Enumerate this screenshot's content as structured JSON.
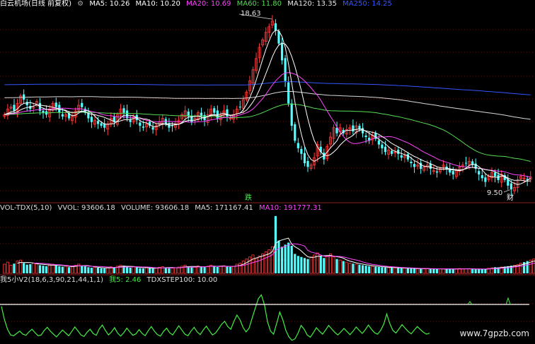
{
  "price_header": {
    "name": "白云机场(日线 前复权)",
    "items": [
      {
        "text": "MA5: 10.26",
        "color": "#ffffff"
      },
      {
        "text": "MA10: 10.20",
        "color": "#ffffff"
      },
      {
        "text": "MA20: 10.69",
        "color": "#ff44ff"
      },
      {
        "text": "MA60: 11.80",
        "color": "#55dd55"
      },
      {
        "text": "MA120: 13.35",
        "color": "#e8e8e8"
      },
      {
        "text": "MA250: 14.25",
        "color": "#3355ff"
      }
    ]
  },
  "vol_header": {
    "name": "VOL-TDX(5,10)",
    "items": [
      {
        "text": "VVOL: 93606.18",
        "color": "#dddddd"
      },
      {
        "text": "VOLUME: 93606.18",
        "color": "#dddddd"
      },
      {
        "text": "MA5: 171167.41",
        "color": "#dddddd"
      },
      {
        "text": "MA10: 191777.31",
        "color": "#ff44ff"
      }
    ]
  },
  "ind_header": {
    "name": "我5小V2(18,6,3,90,21,44,1,1)",
    "items": [
      {
        "text": "我5: 2.46",
        "color": "#44ee44"
      },
      {
        "text": "TDXSTEP100: 10.00",
        "color": "#dddddd"
      }
    ]
  },
  "annotations": {
    "high_label": "18.63",
    "low_label": "9.50",
    "event_1": "跌",
    "event_2": "财"
  },
  "watermark": "www.7gpzb.com",
  "chart_data": [
    {
      "type": "candlestick",
      "title": "白云机场(日线 前复权)",
      "ylim": [
        9.0,
        19.2
      ],
      "grid": true,
      "legend": "top-left",
      "close": [
        13.6,
        13.9,
        14.0,
        13.8,
        14.2,
        14.6,
        14.4,
        14.1,
        13.9,
        14.0,
        14.3,
        13.8,
        13.7,
        13.6,
        13.9,
        14.2,
        14.0,
        13.7,
        13.5,
        13.6,
        13.4,
        13.5,
        13.8,
        14.1,
        14.0,
        13.7,
        13.4,
        13.2,
        13.3,
        13.1,
        13.0,
        12.9,
        13.1,
        13.4,
        13.2,
        13.6,
        13.9,
        13.7,
        13.4,
        13.2,
        13.5,
        13.3,
        13.0,
        12.9,
        13.1,
        13.0,
        12.8,
        13.0,
        13.2,
        13.4,
        13.1,
        12.9,
        13.0,
        13.1,
        13.3,
        13.6,
        13.8,
        13.5,
        13.2,
        13.4,
        13.7,
        13.5,
        13.3,
        13.6,
        13.9,
        13.7,
        13.4,
        13.6,
        13.8,
        13.5,
        13.4,
        13.6,
        13.9,
        14.0,
        14.4,
        14.8,
        15.4,
        16.0,
        16.6,
        17.2,
        17.6,
        18.0,
        18.3,
        18.6,
        18.1,
        17.4,
        16.5,
        15.4,
        14.2,
        13.0,
        12.2,
        11.8,
        11.5,
        11.0,
        10.8,
        10.9,
        11.3,
        12.0,
        11.6,
        11.2,
        11.9,
        12.4,
        12.9,
        12.6,
        12.9,
        12.6,
        12.8,
        12.9,
        12.7,
        13.0,
        12.8,
        12.6,
        12.4,
        12.2,
        12.5,
        12.3,
        12.0,
        11.8,
        11.6,
        11.7,
        11.5,
        11.6,
        11.5,
        11.3,
        11.4,
        11.2,
        11.0,
        10.8,
        10.9,
        10.7,
        10.8,
        10.9,
        10.7,
        10.6,
        10.5,
        10.7,
        10.9,
        10.7,
        10.5,
        10.4,
        10.6,
        10.8,
        10.9,
        11.0,
        11.1,
        10.9,
        10.7,
        10.4,
        10.2,
        10.0,
        10.3,
        10.5,
        10.3,
        10.1,
        10.4,
        10.1,
        9.8,
        9.6,
        9.7,
        10.1,
        10.3,
        10.2,
        10.1,
        10.26
      ],
      "markers": {
        "high": 18.63,
        "low": 9.5
      }
    },
    {
      "type": "bar",
      "title": "VOL-TDX(5,10)",
      "ylim": [
        0,
        600000
      ],
      "legend": "top-left",
      "values": [
        90000,
        110000,
        80000,
        95000,
        120000,
        130000,
        100000,
        85000,
        90000,
        100000,
        95000,
        80000,
        75000,
        70000,
        85000,
        90000,
        80000,
        70000,
        65000,
        70000,
        60000,
        65000,
        80000,
        90000,
        75000,
        70000,
        60000,
        55000,
        60000,
        55000,
        50000,
        48000,
        55000,
        65000,
        60000,
        70000,
        80000,
        75000,
        60000,
        55000,
        65000,
        60000,
        50000,
        48000,
        55000,
        52000,
        48000,
        52000,
        60000,
        65000,
        55000,
        50000,
        52000,
        55000,
        62000,
        70000,
        80000,
        65000,
        58000,
        62000,
        72000,
        66000,
        60000,
        70000,
        80000,
        74000,
        62000,
        68000,
        75000,
        66000,
        62000,
        70000,
        90000,
        100000,
        120000,
        140000,
        160000,
        180000,
        150000,
        170000,
        190000,
        210000,
        230000,
        260000,
        560000,
        320000,
        260000,
        280000,
        300000,
        270000,
        190000,
        170000,
        160000,
        150000,
        140000,
        160000,
        180000,
        200000,
        170000,
        150000,
        170000,
        190000,
        160000,
        140000,
        130000,
        120000,
        110000,
        100000,
        95000,
        90000,
        85000,
        80000,
        75000,
        70000,
        68000,
        65000,
        62000,
        60000,
        58000,
        56000,
        55000,
        54000,
        52000,
        50000,
        50000,
        48000,
        47000,
        46000,
        45000,
        44000,
        45000,
        46000,
        44000,
        43000,
        42000,
        44000,
        45000,
        43000,
        42000,
        41000,
        45000,
        48000,
        46000,
        44000,
        43000,
        42000,
        40000,
        40000,
        42000,
        45000,
        50000,
        55000,
        60000,
        58000,
        62000,
        66000,
        70000,
        75000,
        80000,
        85000,
        100000,
        110000,
        120000,
        130000,
        140000,
        93606.18
      ]
    },
    {
      "type": "line",
      "title": "我5小V2(18,6,3,90,21,44,1,1)",
      "ylim": [
        0,
        15
      ],
      "legend": "top-left",
      "series": [
        {
          "name": "我5",
          "values": [
            9.5,
            6.0,
            3.5,
            2.0,
            1.8,
            2.4,
            3.0,
            2.2,
            1.9,
            2.8,
            3.5,
            2.6,
            1.8,
            2.0,
            3.2,
            4.0,
            3.0,
            2.2,
            1.5,
            2.4,
            3.3,
            2.5,
            1.8,
            2.9,
            4.1,
            3.1,
            2.0,
            1.6,
            2.7,
            3.5,
            2.4,
            1.9,
            3.6,
            4.6,
            3.2,
            2.0,
            2.8,
            3.9,
            2.5,
            1.7,
            2.6,
            3.8,
            2.8,
            1.9,
            2.3,
            3.4,
            2.4,
            1.8,
            3.1,
            4.2,
            3.0,
            2.1,
            1.7,
            2.9,
            3.8,
            2.6,
            2.0,
            3.2,
            4.4,
            3.3,
            2.2,
            1.8,
            3.0,
            4.0,
            2.8,
            2.1,
            3.3,
            4.3,
            3.1,
            2.0,
            2.5,
            3.6,
            4.8,
            5.6,
            4.2,
            3.5,
            5.5,
            7.2,
            6.0,
            4.0,
            2.8,
            3.8,
            6.5,
            9.0,
            11.5,
            12.5,
            10.0,
            5.5,
            3.0,
            2.2,
            5.0,
            8.0,
            6.0,
            3.2,
            1.5,
            0.6,
            1.0,
            2.5,
            4.5,
            3.5,
            2.0,
            1.4,
            2.6,
            3.9,
            3.0,
            2.2,
            3.3,
            4.5,
            3.6,
            2.7,
            2.0,
            2.8,
            3.7,
            2.9,
            2.1,
            3.0,
            4.1,
            3.2,
            2.4,
            3.4,
            4.6,
            3.5,
            2.6,
            2.2,
            3.2,
            4.8,
            7.5,
            5.0,
            3.2,
            2.5,
            3.6,
            4.7,
            3.8,
            2.9,
            2.3,
            3.3,
            4.2,
            3.4,
            2.7,
            2.2,
            2.46
          ]
        },
        {
          "name": "TDXSTEP100",
          "values": [
            10,
            10
          ]
        }
      ]
    }
  ]
}
